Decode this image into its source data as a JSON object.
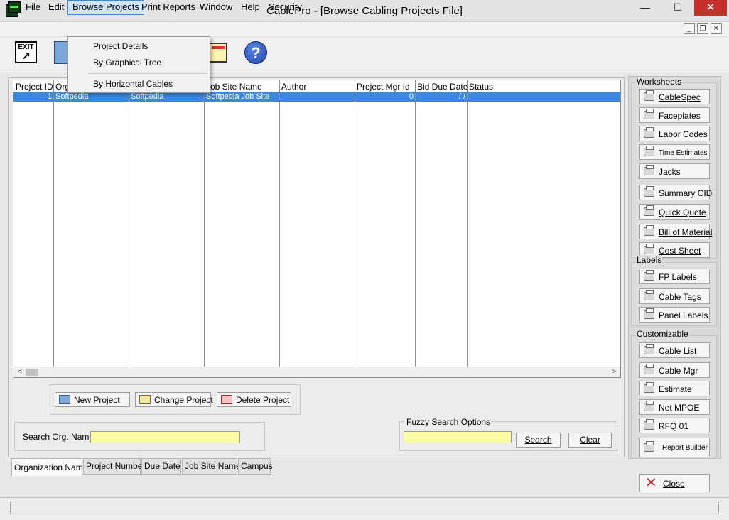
{
  "window": {
    "title": "CablePro - [Browse Cabling Projects File]",
    "minimize": "—",
    "maximize": "☐",
    "close": "✕"
  },
  "menubar": {
    "items": [
      "File",
      "Edit",
      "Browse Projects",
      "Print Reports",
      "Window",
      "Help",
      "Security"
    ],
    "active": "Browse Projects",
    "mdi": {
      "min": "_",
      "restore": "❐",
      "close": "✕"
    }
  },
  "toolbar": {
    "exit": "EXIT",
    "exit_arrow": "↗",
    "help": "?"
  },
  "dropdown": {
    "items": [
      "Project Details",
      "By Graphical Tree",
      "By Horizontal Cables"
    ]
  },
  "grid": {
    "columns": [
      "Project ID",
      "Org",
      "",
      "Job Site Name",
      "Author",
      "Project Mgr Id",
      "Bid Due Date",
      "Status"
    ],
    "rows": [
      {
        "project_id": "1",
        "org": "Softpedia",
        "col3": "Softpedia",
        "job_site": "Softpedia Job Site",
        "author": "",
        "mgr_id": "0",
        "bid_due": "/  /",
        "status": ""
      }
    ],
    "scroll_left": "<",
    "scroll_right": ">"
  },
  "actions": {
    "new": "New Project",
    "change": "Change Project",
    "delete": "Delete Project"
  },
  "search": {
    "label": "Search Org. Name:",
    "value": ""
  },
  "fuzzy": {
    "legend": "Fuzzy Search Options",
    "value": "",
    "search": "Search",
    "clear": "Clear"
  },
  "tabs": [
    "Organization Name",
    "Project Number",
    "Due Date",
    "Job Site Name",
    "Campus"
  ],
  "active_tab": "Organization Name",
  "right": {
    "worksheets_label": "Worksheets",
    "worksheets": [
      "CableSpec",
      "Faceplates",
      "Labor Codes",
      "Time Estimates",
      "Jacks",
      "Summary CID",
      "Quick Quote",
      "Bill of Material",
      "Cost Sheet"
    ],
    "labels_label": "Labels",
    "labels": [
      "FP Labels",
      "Cable Tags",
      "Panel Labels"
    ],
    "custom_label": "Customizable",
    "custom": [
      "Cable List",
      "Cable Mgr",
      "Estimate",
      "Net MPOE",
      "RFQ 01",
      "Report Builder"
    ],
    "close": "Close"
  },
  "colors": {
    "selection": "#3a88e0",
    "input_yellow": "#fdfda6",
    "menu_active": "#cce4f7",
    "close_red": "#c7302b"
  }
}
